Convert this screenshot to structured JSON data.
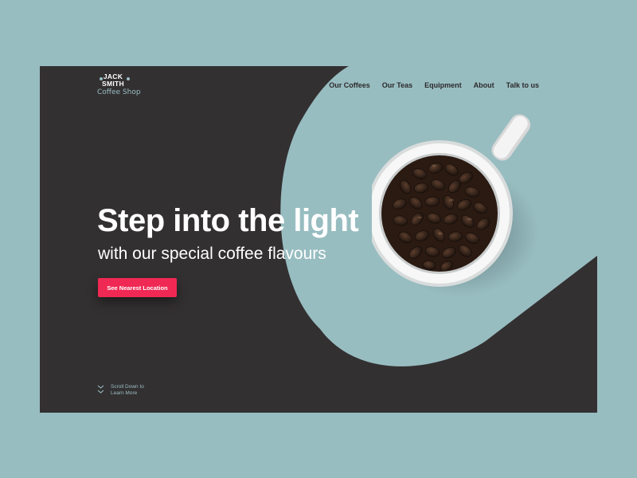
{
  "logo": {
    "line1": "JACK",
    "line2": "SMITH",
    "subtitle": "Coffee Shop"
  },
  "nav": {
    "items": [
      {
        "label": "Our Coffees"
      },
      {
        "label": "Our Teas"
      },
      {
        "label": "Equipment"
      },
      {
        "label": "About"
      },
      {
        "label": "Talk to us"
      }
    ]
  },
  "hero": {
    "title_part1": "Step into the ",
    "title_part2": "light",
    "subtitle": "with our special coffee flavours",
    "cta_label": "See Nearest Location"
  },
  "scroll": {
    "line1": "Scroll Down to",
    "line2": "Learn More"
  },
  "colors": {
    "page_bg": "#98bdc1",
    "panel_bg": "#333032",
    "accent_teal": "#98bdc1",
    "cta_red": "#ef2953",
    "text_light": "#ffffff",
    "nav_text": "#2c2a2b"
  },
  "icons": {
    "mug": "coffee-cup-with-beans-image",
    "scroll": "double-chevron-down-icon",
    "logo_dots": "dot-icon"
  }
}
